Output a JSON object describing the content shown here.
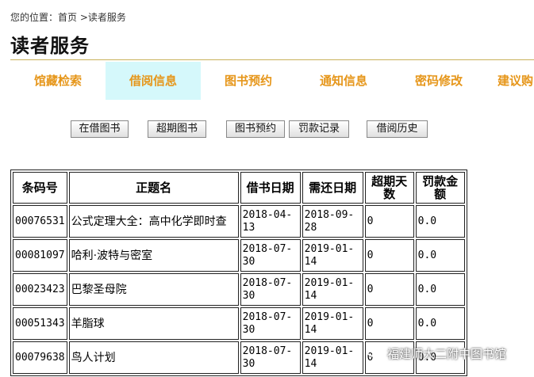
{
  "breadcrumb": {
    "prefix": "您的位置：",
    "home": "首页",
    "sep": " >",
    "current": "读者服务"
  },
  "page_title": "读者服务",
  "nav": [
    {
      "label": "馆藏检索",
      "active": false
    },
    {
      "label": "借阅信息",
      "active": true
    },
    {
      "label": "图书预约",
      "active": false
    },
    {
      "label": "通知信息",
      "active": false
    },
    {
      "label": "密码修改",
      "active": false
    },
    {
      "label": "建议购",
      "active": false
    }
  ],
  "buttons": [
    "在借图书",
    "超期图书",
    "图书预约",
    "罚款记录",
    "借阅历史"
  ],
  "table": {
    "headers": [
      "条码号",
      "正题名",
      "借书日期",
      "需还日期",
      "超期天数",
      "罚款金额"
    ],
    "rows": [
      [
        "00076531",
        "公式定理大全：高中化学即时查",
        "2018-04-13",
        "2018-09-28",
        "0",
        "0.0"
      ],
      [
        "00081097",
        "哈利·波特与密室",
        "2018-07-30",
        "2019-01-14",
        "0",
        "0.0"
      ],
      [
        "00023423",
        "巴黎圣母院",
        "2018-07-30",
        "2019-01-14",
        "0",
        "0.0"
      ],
      [
        "00051343",
        "羊脂球",
        "2018-07-30",
        "2019-01-14",
        "0",
        "0.0"
      ],
      [
        "00079638",
        "鸟人计划",
        "2018-07-30",
        "2019-01-14",
        "0",
        "0.0"
      ]
    ]
  },
  "watermark": {
    "text": "福建师大二附中图书馆",
    "icon": "wechat-icon"
  },
  "colors": {
    "accent": "#e6961a",
    "active_tab_bg": "#d5f8fb",
    "rule": "#c9b25a"
  }
}
